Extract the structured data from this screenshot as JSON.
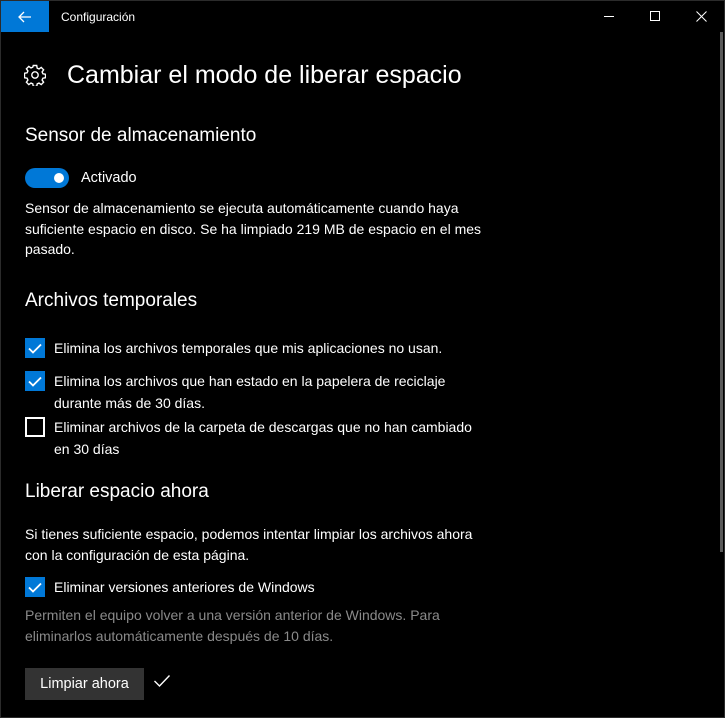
{
  "window": {
    "title": "Configuración",
    "icons": {
      "back": "arrow-left-icon",
      "minimize": "minimize-icon",
      "maximize": "maximize-icon",
      "close": "close-icon"
    }
  },
  "page": {
    "icon": "gear-icon",
    "title": "Cambiar el modo de liberar espacio"
  },
  "storage_sense": {
    "heading": "Sensor de almacenamiento",
    "toggle_state": "Activado",
    "toggle_on": true,
    "description": "Sensor de almacenamiento se ejecuta automáticamente cuando haya suficiente espacio en disco. Se ha limpiado 219 MB de espacio en el mes pasado."
  },
  "temp_files": {
    "heading": "Archivos temporales",
    "options": [
      {
        "label": "Elimina los archivos temporales que mis aplicaciones no usan.",
        "checked": true
      },
      {
        "label": "Elimina los archivos que han estado en la papelera de reciclaje durante más de 30 días.",
        "checked": true
      },
      {
        "label": "Eliminar archivos de la carpeta de descargas que no han cambiado en 30 días",
        "checked": false
      }
    ]
  },
  "free_now": {
    "heading": "Liberar espacio ahora",
    "description": "Si tienes suficiente espacio, podemos intentar limpiar los archivos ahora con la configuración de esta página.",
    "option": {
      "label": "Eliminar versiones anteriores de Windows",
      "checked": true
    },
    "note": "Permiten el equipo volver a una versión anterior de Windows. Para eliminarlos automáticamente después de 10 días.",
    "button_label": "Limpiar ahora",
    "done_icon": "checkmark-icon"
  },
  "colors": {
    "accent": "#0078d7",
    "background": "#000000",
    "text": "#ffffff",
    "dim_text": "#8a8a8a",
    "button": "#333333"
  }
}
